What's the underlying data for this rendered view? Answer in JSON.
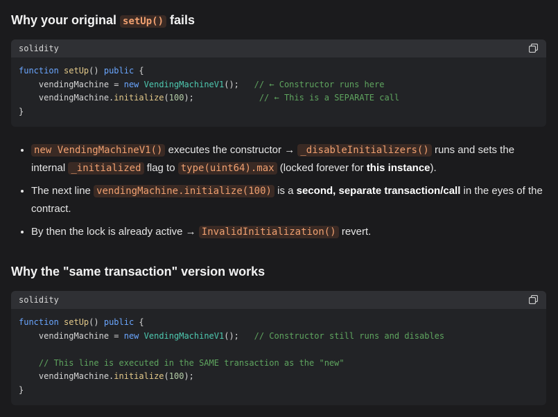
{
  "section1": {
    "title_prefix": "Why your original ",
    "title_code": "setUp()",
    "title_suffix": " fails"
  },
  "code1": {
    "lang": "solidity",
    "l1_kw": "function",
    "l1_fn": "setUp",
    "l1_paren": "() ",
    "l1_kw2": "public",
    "l1_brace": " {",
    "l2_a": "    vendingMachine = ",
    "l2_kw": "new",
    "l2_ty": "VendingMachineV1",
    "l2_b": "();   ",
    "l2_cm": "// ← Constructor runs here",
    "l3_a": "    vendingMachine.",
    "l3_fn": "initialize",
    "l3_b": "(",
    "l3_num": "100",
    "l3_c": ");             ",
    "l3_cm": "// ← This is a SEPARATE call",
    "l4": "}"
  },
  "bullets": {
    "b1_code1": "new VendingMachineV1()",
    "b1_t1": " executes the constructor → ",
    "b1_code2": "_disableInitializers()",
    "b1_t2": " runs and sets the internal ",
    "b1_code3": "_initialized",
    "b1_t3": " flag to ",
    "b1_code4": "type(uint64).max",
    "b1_t4": " (locked forever for ",
    "b1_bold": "this instance",
    "b1_t5": ").",
    "b2_t1": "The next line ",
    "b2_code1": "vendingMachine.initialize(100)",
    "b2_t2": " is a ",
    "b2_bold": "second, separate transaction/call",
    "b2_t3": " in the eyes of the contract.",
    "b3_t1": "By then the lock is already active → ",
    "b3_code1": "InvalidInitialization()",
    "b3_t2": " revert."
  },
  "section2": {
    "title": "Why the \"same transaction\" version works"
  },
  "code2": {
    "lang": "solidity",
    "l1_kw": "function",
    "l1_fn": "setUp",
    "l1_paren": "() ",
    "l1_kw2": "public",
    "l1_brace": " {",
    "l2_a": "    vendingMachine = ",
    "l2_kw": "new",
    "l2_ty": "VendingMachineV1",
    "l2_b": "();   ",
    "l2_cm": "// Constructor still runs and disables",
    "l4_cm": "    // This line is executed in the SAME transaction as the \"new\"",
    "l5_a": "    vendingMachine.",
    "l5_fn": "initialize",
    "l5_b": "(",
    "l5_num": "100",
    "l5_c": ");",
    "l6": "}"
  },
  "icons": {
    "copy": "copy-icon"
  }
}
